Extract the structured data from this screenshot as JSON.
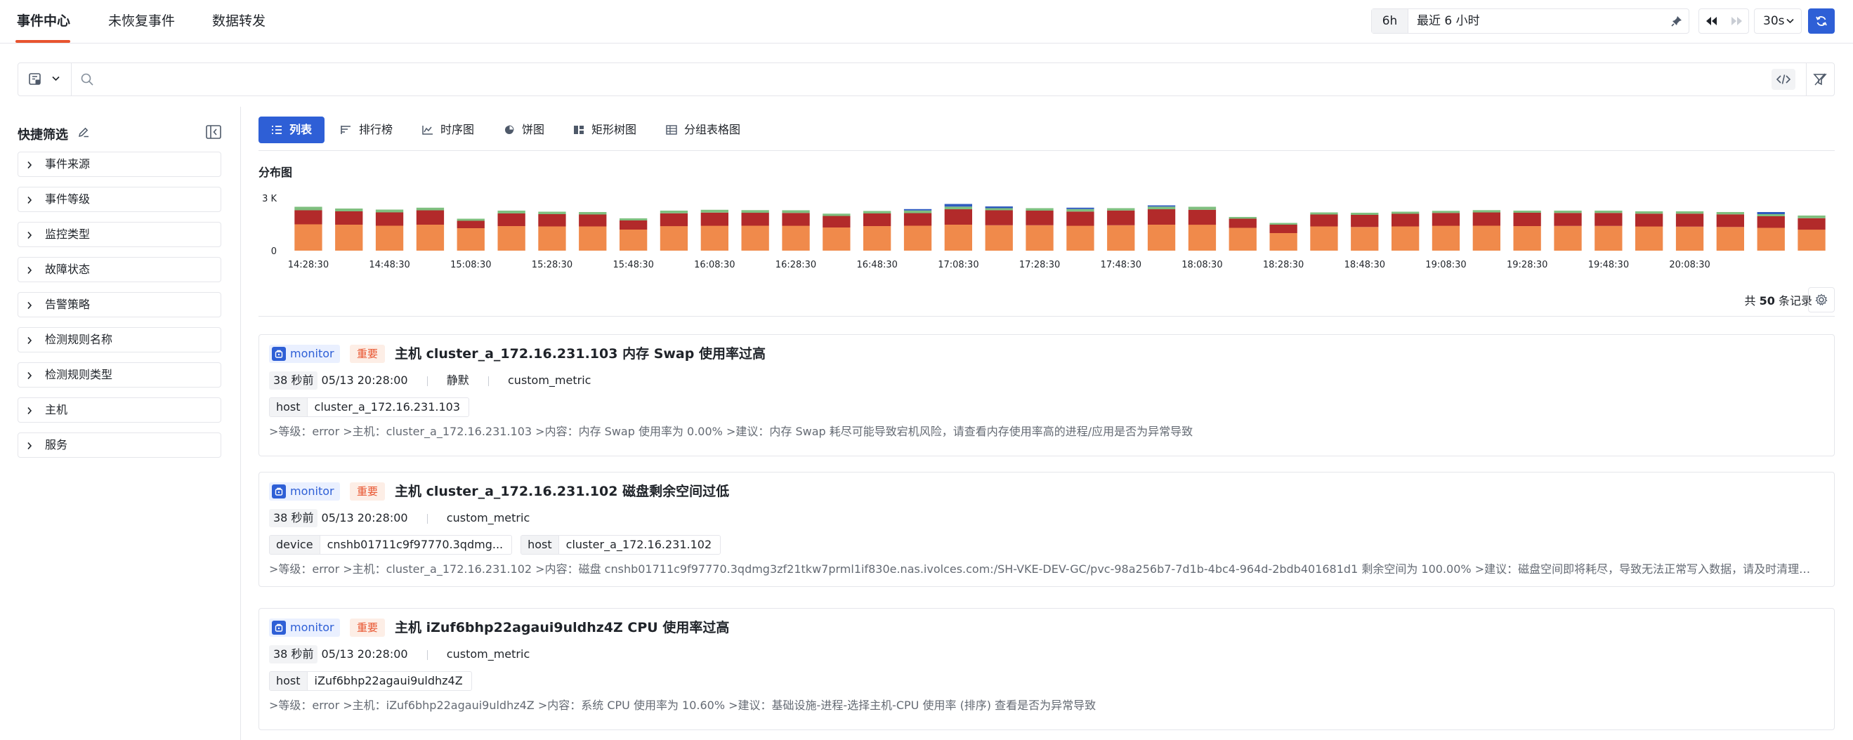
{
  "nav": {
    "tabs": [
      {
        "label": "事件中心",
        "active": true
      },
      {
        "label": "未恢复事件",
        "active": false
      },
      {
        "label": "数据转发",
        "active": false
      }
    ],
    "accent": "#e8542f"
  },
  "time": {
    "range_tag": "6h",
    "range_text": "最近 6 小时",
    "refresh_interval": "30s"
  },
  "search": {
    "placeholder": "",
    "value": ""
  },
  "sidebar": {
    "title": "快捷筛选",
    "facets": [
      "事件来源",
      "事件等级",
      "监控类型",
      "故障状态",
      "告警策略",
      "检测规则名称",
      "检测规则类型",
      "主机",
      "服务"
    ]
  },
  "view_tabs": [
    {
      "label": "列表",
      "icon": "list-icon",
      "active": true
    },
    {
      "label": "排行榜",
      "icon": "ranking-icon",
      "active": false
    },
    {
      "label": "时序图",
      "icon": "timeseries-icon",
      "active": false
    },
    {
      "label": "饼图",
      "icon": "pie-icon",
      "active": false
    },
    {
      "label": "矩形树图",
      "icon": "treemap-icon",
      "active": false
    },
    {
      "label": "分组表格图",
      "icon": "grouped-table-icon",
      "active": false
    }
  ],
  "distribution": {
    "title": "分布图"
  },
  "chart_data": {
    "type": "bar",
    "stacked": true,
    "ylim": [
      0,
      3000
    ],
    "y_ticks": [
      {
        "value": 0,
        "label": "0"
      },
      {
        "value": 3000,
        "label": "3 K"
      }
    ],
    "x_tick_labels": [
      "14:28:30",
      "14:48:30",
      "15:08:30",
      "15:28:30",
      "15:48:30",
      "16:08:30",
      "16:28:30",
      "16:48:30",
      "17:08:30",
      "17:28:30",
      "17:48:30",
      "18:08:30",
      "18:28:30",
      "18:48:30",
      "19:08:30",
      "19:28:30",
      "19:48:30",
      "20:08:30"
    ],
    "series": [
      {
        "color": "#f08a4b",
        "values": [
          1500,
          1480,
          1420,
          1480,
          1280,
          1400,
          1380,
          1380,
          1200,
          1400,
          1420,
          1420,
          1420,
          1320,
          1400,
          1420,
          1480,
          1450,
          1450,
          1420,
          1450,
          1480,
          1480,
          1300,
          1000,
          1380,
          1350,
          1380,
          1420,
          1420,
          1400,
          1410,
          1410,
          1380,
          1370,
          1350,
          1300,
          1200
        ]
      },
      {
        "color": "#b22a2a",
        "values": [
          800,
          760,
          760,
          820,
          420,
          720,
          700,
          680,
          520,
          730,
          750,
          740,
          730,
          660,
          720,
          720,
          880,
          850,
          830,
          810,
          840,
          880,
          850,
          520,
          480,
          680,
          690,
          720,
          730,
          760,
          760,
          740,
          740,
          730,
          740,
          720,
          660,
          650
        ]
      },
      {
        "color": "#7fbf7f",
        "values": [
          200,
          160,
          160,
          150,
          120,
          160,
          140,
          140,
          120,
          150,
          160,
          150,
          150,
          130,
          140,
          150,
          150,
          120,
          140,
          140,
          130,
          150,
          170,
          100,
          100,
          120,
          120,
          120,
          120,
          130,
          120,
          130,
          130,
          130,
          130,
          130,
          120,
          150
        ]
      },
      {
        "color": "#2f5bbf",
        "values": [
          0,
          0,
          0,
          0,
          0,
          0,
          0,
          0,
          0,
          0,
          0,
          0,
          0,
          0,
          0,
          80,
          150,
          100,
          0,
          80,
          0,
          70,
          0,
          0,
          0,
          0,
          0,
          0,
          0,
          0,
          0,
          0,
          0,
          0,
          0,
          0,
          120,
          0
        ]
      }
    ]
  },
  "records": {
    "prefix": "共",
    "count": "50",
    "suffix": "条记录"
  },
  "events": [
    {
      "source": "monitor",
      "level": "重要",
      "title": "主机 cluster_a_172.16.231.103 内存 Swap 使用率过高",
      "ago": "38 秒前",
      "time": "05/13 20:28:00",
      "extra": "静默",
      "type": "custom_metric",
      "tags": [
        {
          "k": "host",
          "v": "cluster_a_172.16.231.103"
        }
      ],
      "message": ">等级：error >主机：cluster_a_172.16.231.103 >内容：内存 Swap 使用率为 0.00% >建议：内存 Swap 耗尽可能导致宕机风险，请查看内存使用率高的进程/应用是否为异常导致"
    },
    {
      "source": "monitor",
      "level": "重要",
      "title": "主机 cluster_a_172.16.231.102 磁盘剩余空间过低",
      "ago": "38 秒前",
      "time": "05/13 20:28:00",
      "extra": "",
      "type": "custom_metric",
      "tags": [
        {
          "k": "device",
          "v": "cnshb01711c9f97770.3qdmg..."
        },
        {
          "k": "host",
          "v": "cluster_a_172.16.231.102"
        }
      ],
      "message": ">等级：error >主机：cluster_a_172.16.231.102 >内容：磁盘 cnshb01711c9f97770.3qdmg3zf21tkw7prml1if830e.nas.ivolces.com:/SH-VKE-DEV-GC/pvc-98a256b7-7d1b-4bc4-964d-2bdb401681d1 剩余空间为 100.00% >建议：磁盘空间即将耗尽，导致无法正常写入数据，请及时清理不必要的文件"
    },
    {
      "source": "monitor",
      "level": "重要",
      "title": "主机 iZuf6bhp22agaui9uldhz4Z CPU 使用率过高",
      "ago": "38 秒前",
      "time": "05/13 20:28:00",
      "extra": "",
      "type": "custom_metric",
      "tags": [
        {
          "k": "host",
          "v": "iZuf6bhp22agaui9uldhz4Z"
        }
      ],
      "message": ">等级：error >主机：iZuf6bhp22agaui9uldhz4Z >内容：系统 CPU 使用率为 10.60% >建议：基础设施-进程-选择主机-CPU 使用率 (排序) 查看是否为异常导致"
    }
  ]
}
